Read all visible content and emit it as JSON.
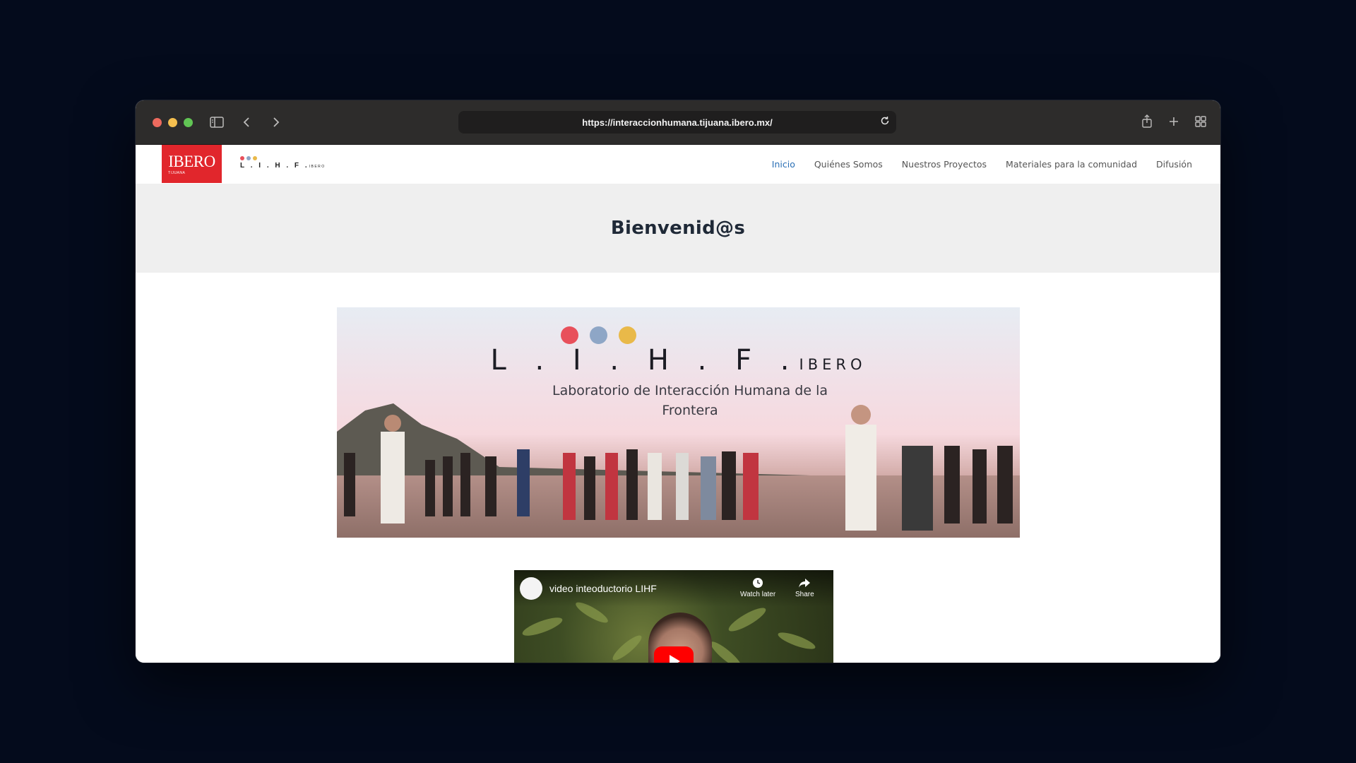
{
  "browser": {
    "url": "https://interaccionhumana.tijuana.ibero.mx/"
  },
  "site": {
    "logo_text": "IBERO",
    "logo_subtext": "TIJUANA",
    "lihf_small": "L . I . H . F .",
    "lihf_small_suffix": "IBERO",
    "dot_colors": [
      "#e8505b",
      "#8ea6c6",
      "#e9b949"
    ],
    "nav": [
      {
        "label": "Inicio",
        "active": true
      },
      {
        "label": "Quiénes Somos",
        "active": false
      },
      {
        "label": "Nuestros Proyectos",
        "active": false
      },
      {
        "label": "Materiales para la comunidad",
        "active": false
      },
      {
        "label": "Difusión",
        "active": false
      }
    ],
    "heading": "Bienvenid@s"
  },
  "banner": {
    "lihf": "L . I . H . F .",
    "lihf_suffix": "IBERO",
    "subtitle": "Laboratorio de Interacción Humana de la Frontera"
  },
  "video": {
    "title": "video inteoductorio LIHF",
    "watch_later": "Watch later",
    "share": "Share"
  }
}
